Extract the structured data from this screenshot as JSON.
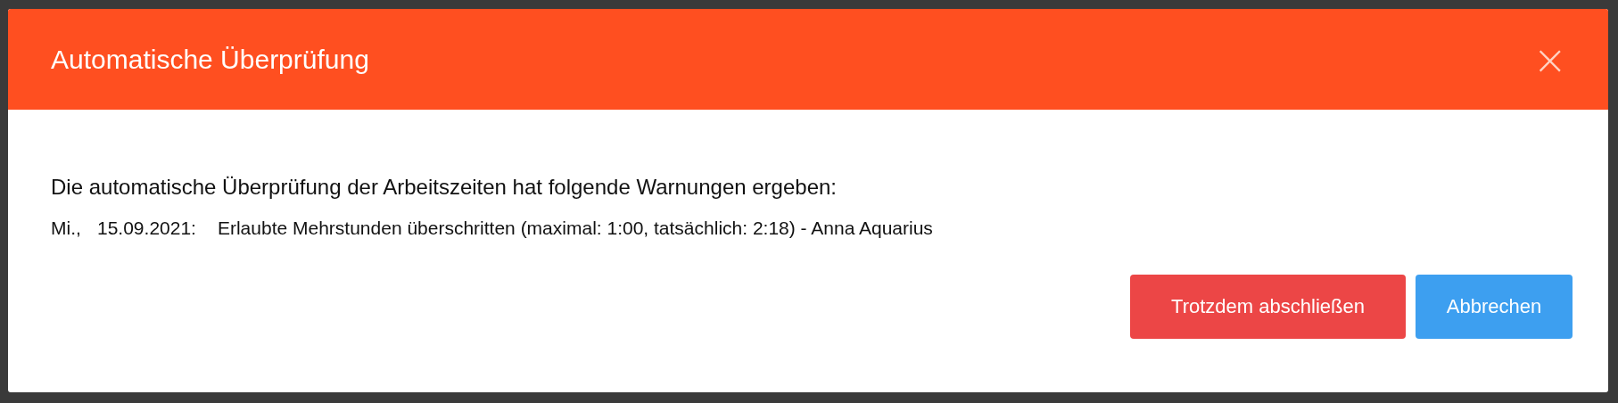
{
  "dialog": {
    "title": "Automatische Überprüfung",
    "close_label": "×",
    "message": "Die automatische Überprüfung der Arbeitszeiten hat folgende Warnungen ergeben:",
    "warnings": [
      {
        "day": "Mi.,",
        "date": "15.09.2021:",
        "text": "Erlaubte Mehrstunden überschritten (maximal: 1:00, tatsächlich: 2:18) - Anna Aquarius"
      }
    ],
    "buttons": [
      {
        "label": "Trotzdem abschließen",
        "kind": "danger"
      },
      {
        "label": "Abbrechen",
        "kind": "primary"
      }
    ]
  }
}
